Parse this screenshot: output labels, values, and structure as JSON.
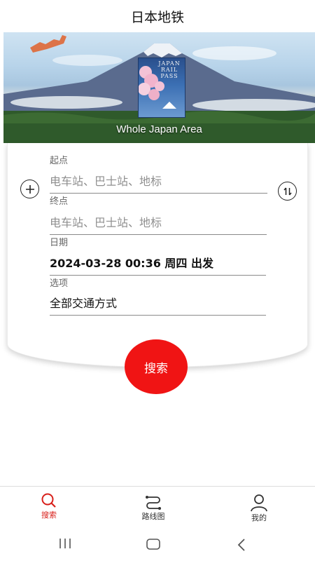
{
  "header": {
    "title": "日本地铁"
  },
  "banner": {
    "pass_lines": [
      "JAPAN",
      "RAIL",
      "PASS"
    ],
    "caption": "Whole Japan Area"
  },
  "form": {
    "origin": {
      "label": "起点",
      "placeholder": "电车站、巴士站、地标"
    },
    "destination": {
      "label": "终点",
      "placeholder": "电车站、巴士站、地标"
    },
    "date": {
      "label": "日期",
      "value": "2024-03-28 00:36 周四 出发"
    },
    "options": {
      "label": "选项",
      "value": "全部交通方式"
    },
    "add_icon": "plus-circle-icon",
    "swap_icon": "swap-arrows-icon"
  },
  "search_button": {
    "label": "搜索",
    "color": "#f01414"
  },
  "bottom_nav": {
    "active_color": "#d8201b",
    "items": [
      {
        "label": "搜索",
        "icon": "search-icon",
        "active": true
      },
      {
        "label": "路线图",
        "icon": "route-map-icon",
        "active": false
      },
      {
        "label": "我的",
        "icon": "profile-icon",
        "active": false
      }
    ]
  },
  "system_bar": {
    "icons": [
      "recent-apps-icon",
      "home-icon",
      "back-icon"
    ]
  }
}
